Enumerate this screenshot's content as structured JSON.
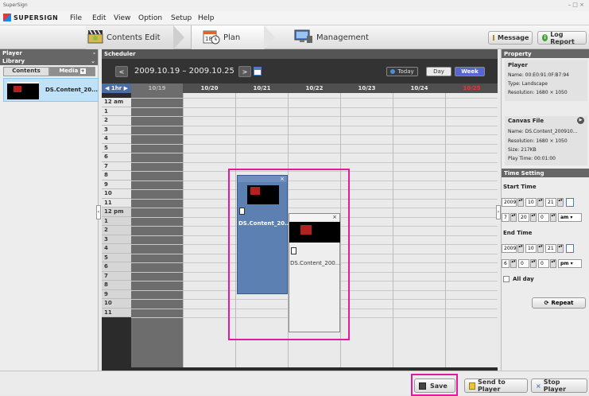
{
  "window": {
    "title": "SuperSign",
    "controls": "– □ ×"
  },
  "menubar": {
    "logo": "SUPERSIGN",
    "items": [
      "File",
      "Edit",
      "View",
      "Option",
      "Setup",
      "Help"
    ]
  },
  "navbar": {
    "tabs": [
      {
        "label": "Contents Edit",
        "icon": "clapperboard-icon"
      },
      {
        "label": "Plan",
        "icon": "calendar-clock-icon",
        "active": true
      },
      {
        "label": "Management",
        "icon": "monitor-icon"
      }
    ],
    "message_label": "Message",
    "log_label": "Log Report"
  },
  "left": {
    "player_label": "Player",
    "library_label": "Library",
    "tab_contents": "Contents",
    "tab_media": "Media",
    "item_label": "DS.Content_20..."
  },
  "scheduler": {
    "header": "Scheduler",
    "prev": "<",
    "next": ">",
    "range": "2009.10.19  –  2009.10.25",
    "today": "Today",
    "day": "Day",
    "week": "Week",
    "interval": "1hr",
    "days": [
      "10/19",
      "10/20",
      "10/21",
      "10/22",
      "10/23",
      "10/24",
      "10/25"
    ],
    "hours": [
      "12 am",
      "1",
      "2",
      "3",
      "4",
      "5",
      "6",
      "7",
      "8",
      "9",
      "10",
      "11",
      "12 pm",
      "1",
      "2",
      "3",
      "4",
      "5",
      "6",
      "7",
      "8",
      "9",
      "10",
      "11"
    ],
    "events": [
      {
        "label": "DS.Content_20...",
        "close": "×"
      },
      {
        "label": "DS.Content_200...",
        "close": "×"
      }
    ]
  },
  "property": {
    "header": "Property",
    "player_title": "Player",
    "name": "Name: 00:E0:91:0F:B7:94",
    "type": "Type: Landscape",
    "resolution": "Resolution: 1680 × 1050",
    "canvas_title": "Canvas File",
    "canvas_name": "Name: DS.Content_200910...",
    "canvas_resolution": "Resolution: 1680 × 1050",
    "canvas_size": "Size: 217KB",
    "play_time": "Play Time: 00:01:00",
    "time_setting": "Time Setting",
    "start_time": "Start Time",
    "start_year": "2009",
    "start_month": "10",
    "start_day": "21",
    "start_hour": "7",
    "start_min": "20",
    "start_sec": "0",
    "start_ampm": "am",
    "end_time": "End Time",
    "end_year": "2009",
    "end_month": "10",
    "end_day": "21",
    "end_hour": "6",
    "end_min": "0",
    "end_sec": "0",
    "end_ampm": "pm",
    "all_day": "All day",
    "repeat": "Repeat"
  },
  "footer": {
    "save": "Save",
    "send": "Send to Player",
    "stop": "Stop Player"
  },
  "colors": {
    "accent": "#e5199c",
    "event_blue": "#5b80b1",
    "weekend_red": "#e53935",
    "week_active": "#5566d6"
  }
}
